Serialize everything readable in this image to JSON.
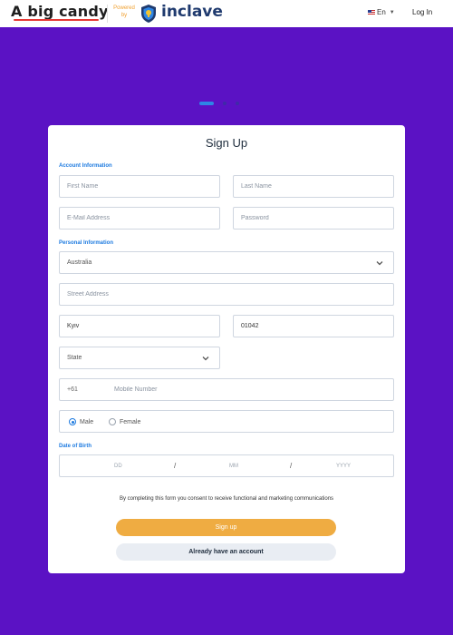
{
  "header": {
    "brand": "A big candy",
    "powered_by": "Powered by",
    "partner": "inclave",
    "language": "En",
    "login": "Log In"
  },
  "colors": {
    "background": "#5b12c4",
    "accent_blue": "#1e7be0",
    "signup_button": "#efac42"
  },
  "carousel": {
    "active_index": 0,
    "count": 3
  },
  "form": {
    "title": "Sign Up",
    "account_section": "Account Information",
    "first_name_placeholder": "First Name",
    "last_name_placeholder": "Last Name",
    "email_placeholder": "E-Mail Address",
    "password_placeholder": "Password",
    "personal_section": "Personal Information",
    "country_value": "Australia",
    "street_placeholder": "Street Address",
    "city_value": "Kyiv",
    "zip_value": "01042",
    "state_placeholder": "State",
    "phone_code": "+61",
    "phone_placeholder": "Mobile Number",
    "gender_male": "Male",
    "gender_female": "Female",
    "gender_selected": "Male",
    "dob_section": "Date of Birth",
    "dob_day": "DD",
    "dob_month": "MM",
    "dob_year": "YYYY",
    "dob_separator": "/",
    "consent_text": "By completing this form you consent to receive functional and marketing communications",
    "signup_button": "Sign up",
    "account_button": "Already have an account"
  },
  "icons": [
    "flag-icon",
    "caret-down-icon",
    "chevron-down-icon",
    "inclave-shield-icon"
  ]
}
